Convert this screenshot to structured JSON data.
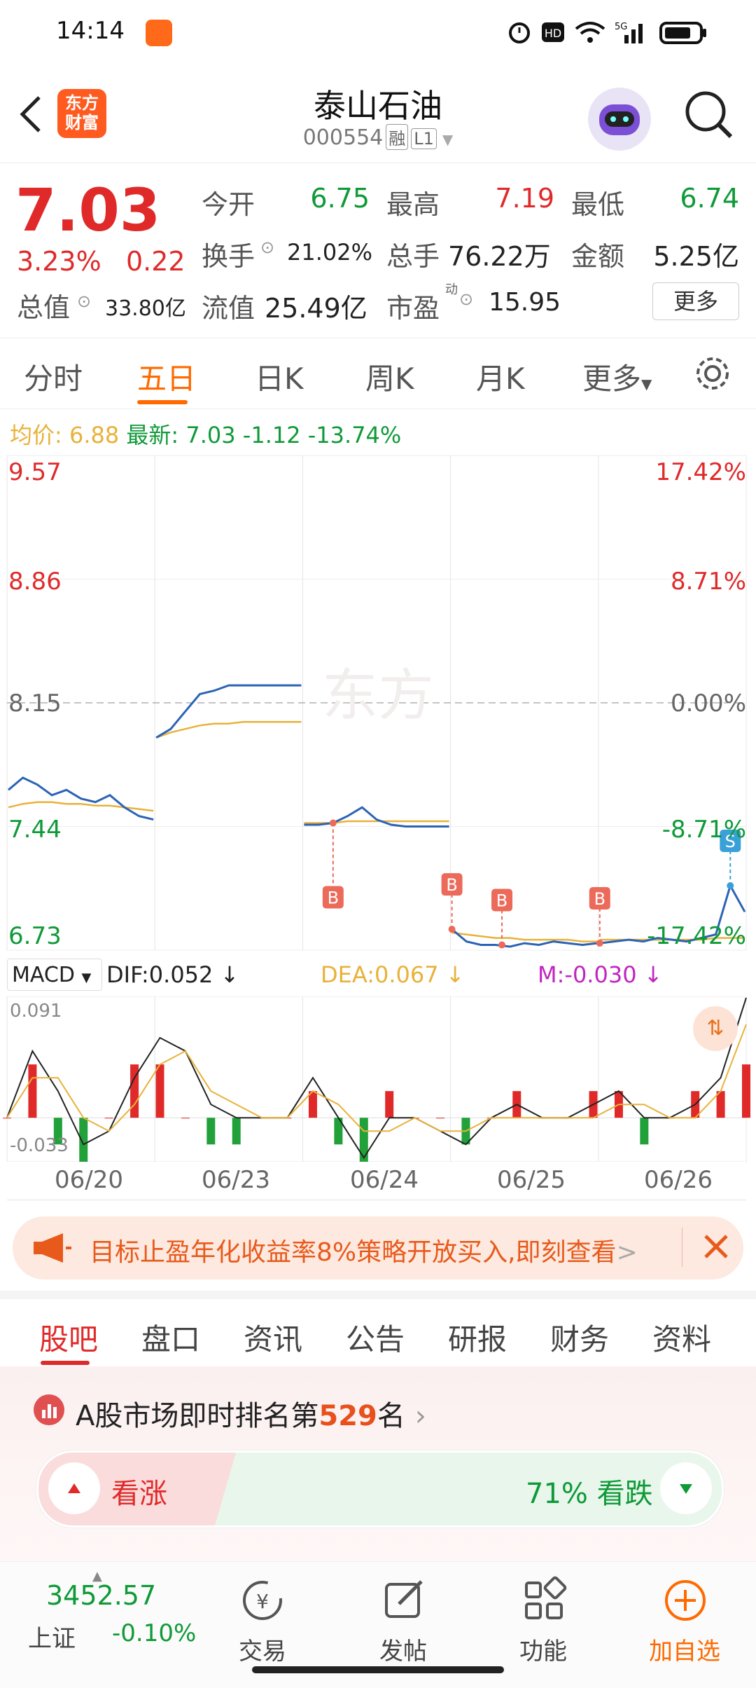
{
  "status_bar": {
    "time": "14:14"
  },
  "header": {
    "logo_line1": "东方",
    "logo_line2": "财富",
    "stock_name": "泰山石油",
    "stock_code": "000554",
    "tag_margin": "融",
    "tag_level": "L1"
  },
  "quote": {
    "price": "7.03",
    "change_pct": "3.23%",
    "change": "0.22",
    "open_label": "今开",
    "open": "6.75",
    "high_label": "最高",
    "high": "7.19",
    "low_label": "最低",
    "low": "6.74",
    "turnover_label": "换手",
    "turnover": "21.02%",
    "volume_label": "总手",
    "volume": "76.22万",
    "amount_label": "金额",
    "amount": "5.25亿",
    "mktcap_label": "总值",
    "mktcap": "33.80亿",
    "float_label": "流值",
    "float": "25.49亿",
    "pe_label": "市盈",
    "pe_sup": "动",
    "pe": "15.95",
    "more_button": "更多"
  },
  "chart_tabs": [
    "分时",
    "五日",
    "日K",
    "周K",
    "月K",
    "更多"
  ],
  "legend": {
    "avg_label": "均价:",
    "avg": "6.88",
    "latest_label": "最新:",
    "latest": "7.03",
    "latest_change": "-1.12",
    "latest_pct": "-13.74%"
  },
  "chart_data": {
    "type": "line",
    "title": "",
    "y_left_ticks": [
      "9.57",
      "8.86",
      "8.15",
      "7.44",
      "6.73"
    ],
    "y_right_ticks": [
      "17.42%",
      "8.71%",
      "0.00%",
      "-8.71%",
      "-17.42%"
    ],
    "ylim": [
      6.73,
      9.57
    ],
    "reference": 8.15,
    "dates": [
      "06/20",
      "06/23",
      "06/24",
      "06/25",
      "06/26"
    ],
    "series": [
      {
        "name": "price",
        "values": [
          [
            7.65,
            7.72,
            7.68,
            7.62,
            7.65,
            7.6,
            7.58,
            7.62,
            7.55,
            7.5,
            7.48
          ],
          [
            7.95,
            8.0,
            8.1,
            8.2,
            8.22,
            8.25,
            8.25,
            8.25,
            8.25,
            8.25,
            8.25
          ],
          [
            7.45,
            7.45,
            7.46,
            7.5,
            7.55,
            7.48,
            7.45,
            7.44,
            7.44,
            7.44,
            7.44
          ],
          [
            6.85,
            6.78,
            6.76,
            6.76,
            6.75,
            6.77,
            6.76,
            6.78,
            6.77,
            6.76,
            6.77
          ],
          [
            6.77,
            6.78,
            6.79,
            6.78,
            6.8,
            6.79,
            6.78,
            6.8,
            6.82,
            7.1,
            6.95
          ]
        ]
      },
      {
        "name": "avg",
        "values": [
          [
            7.55,
            7.57,
            7.58,
            7.58,
            7.57,
            7.57,
            7.56,
            7.56,
            7.55,
            7.54,
            7.53
          ],
          [
            7.95,
            7.98,
            8.0,
            8.02,
            8.03,
            8.03,
            8.04,
            8.04,
            8.04,
            8.04,
            8.04
          ],
          [
            7.46,
            7.46,
            7.46,
            7.47,
            7.47,
            7.47,
            7.47,
            7.47,
            7.47,
            7.47,
            7.47
          ],
          [
            6.83,
            6.82,
            6.81,
            6.8,
            6.8,
            6.79,
            6.79,
            6.79,
            6.79,
            6.78,
            6.78
          ],
          [
            6.79,
            6.79,
            6.79,
            6.79,
            6.79,
            6.79,
            6.79,
            6.79,
            6.8,
            6.8,
            6.8
          ]
        ]
      }
    ],
    "markers": [
      "B",
      "B",
      "B",
      "B",
      "S"
    ]
  },
  "macd": {
    "selector": "MACD",
    "dif": "DIF:0.052",
    "dea": "DEA:0.067",
    "m": "M:-0.030",
    "top": "0.091",
    "bottom": "-0.033",
    "dif_values": [
      0.0,
      0.05,
      0.02,
      -0.02,
      -0.01,
      0.03,
      0.06,
      0.05,
      0.01,
      0.0,
      0.0,
      0.0,
      0.03,
      0.0,
      -0.03,
      0.0,
      0.0,
      -0.01,
      -0.02,
      0.0,
      0.01,
      0.0,
      0.0,
      0.01,
      0.02,
      0.0,
      0.0,
      0.01,
      0.03,
      0.09
    ],
    "dea_values": [
      0.0,
      0.03,
      0.03,
      0.0,
      -0.01,
      0.01,
      0.04,
      0.05,
      0.02,
      0.01,
      0.0,
      0.0,
      0.02,
      0.01,
      -0.01,
      -0.01,
      0.0,
      -0.01,
      -0.01,
      0.0,
      0.0,
      0.0,
      0.0,
      0.0,
      0.01,
      0.01,
      0.0,
      0.0,
      0.02,
      0.07
    ]
  },
  "banner": {
    "text": "目标止盈年化收益率8%策略开放买入,即刻查看",
    "arrow": ">"
  },
  "info_tabs": [
    "股吧",
    "盘口",
    "资讯",
    "公告",
    "研报",
    "财务",
    "资料"
  ],
  "ranking": {
    "prefix": "A股市场即时排名第",
    "rank": "529",
    "suffix": "名"
  },
  "vote": {
    "up_label": "看涨",
    "down_label": "71% 看跌"
  },
  "bottom_nav": {
    "index_value": "3452.57",
    "index_name": "上证",
    "index_change": "-0.10%",
    "trade": "交易",
    "post": "发帖",
    "functions": "功能",
    "add_watch": "加自选"
  },
  "colors": {
    "accent": "#ff6a00",
    "up": "#e02a2a",
    "down": "#0f9a38",
    "line": "#2b63b5",
    "avg": "#e8b23a"
  }
}
